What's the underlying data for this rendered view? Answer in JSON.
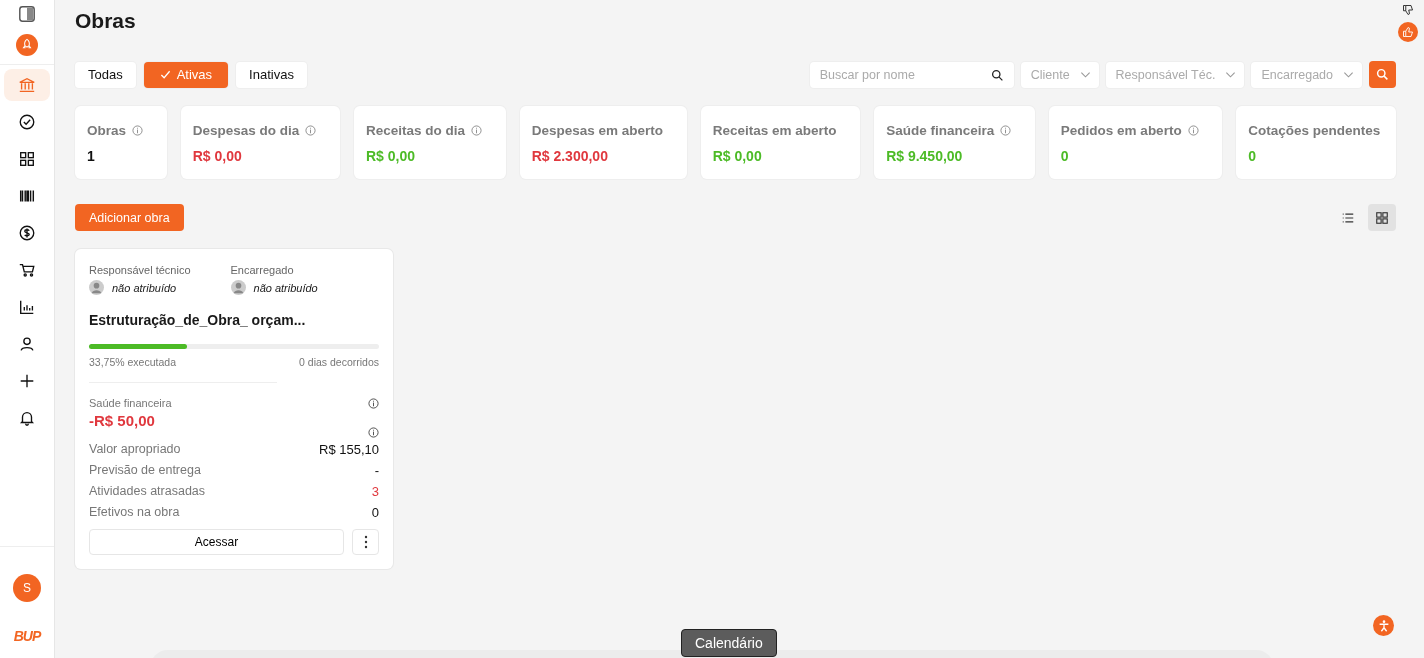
{
  "sidebar": {
    "items": [
      {
        "kind": "bank",
        "selected": true
      },
      {
        "kind": "check",
        "selected": false
      },
      {
        "kind": "grid",
        "selected": false
      },
      {
        "kind": "barcode",
        "selected": false
      },
      {
        "kind": "dollar",
        "selected": false
      },
      {
        "kind": "cart",
        "selected": false
      },
      {
        "kind": "chart",
        "selected": false
      },
      {
        "kind": "user",
        "selected": false
      },
      {
        "kind": "plus",
        "selected": false
      },
      {
        "kind": "bell",
        "selected": false
      }
    ],
    "avatar": "S",
    "logo": "BUP"
  },
  "title": "Obras",
  "tabs": [
    {
      "label": "Todas",
      "selected": false
    },
    {
      "label": "Ativas",
      "selected": true
    },
    {
      "label": "Inativas",
      "selected": false
    }
  ],
  "search": {
    "placeholder": "Buscar por nome"
  },
  "filters": [
    {
      "placeholder": "Cliente"
    },
    {
      "placeholder": "Responsável Téc."
    },
    {
      "placeholder": "Encarregado"
    }
  ],
  "stats": [
    {
      "label": "Obras",
      "value": "1",
      "color": "#111111",
      "info": true
    },
    {
      "label": "Despesas do dia",
      "value": "R$ 0,00",
      "color": "#e0383e",
      "info": true
    },
    {
      "label": "Receitas do dia",
      "value": "R$ 0,00",
      "color": "#4cbb26",
      "info": true
    },
    {
      "label": "Despesas em aberto",
      "value": "R$ 2.300,00",
      "color": "#e0383e",
      "info": false
    },
    {
      "label": "Receitas em aberto",
      "value": "R$ 0,00",
      "color": "#4cbb26",
      "info": false
    },
    {
      "label": "Saúde financeira",
      "value": "R$ 9.450,00",
      "color": "#4cbb26",
      "info": true
    },
    {
      "label": "Pedidos em aberto",
      "value": "0",
      "color": "#4cbb26",
      "info": true
    },
    {
      "label": "Cotações pendentes",
      "value": "0",
      "color": "#4cbb26",
      "info": false
    }
  ],
  "add_button": "Adicionar obra",
  "view_modes": [
    {
      "kind": "list",
      "selected": false
    },
    {
      "kind": "grid",
      "selected": true
    }
  ],
  "project": {
    "people": [
      {
        "role": "Responsável técnico",
        "name": "não atribuído"
      },
      {
        "role": "Encarregado",
        "name": "não atribuído"
      }
    ],
    "name": "Estruturação_de_Obra_ orçam...",
    "level": 0.3375,
    "executed": "33,75% executada",
    "elapsed": "0 dias decorridos",
    "health_label": "Saúde financeira",
    "health_value": "-R$ 50,00",
    "details": [
      {
        "label": "Valor apropriado",
        "value": "R$ 155,10",
        "kind": "plain"
      },
      {
        "label": "Previsão de entrega",
        "value": "-",
        "kind": "plain"
      },
      {
        "label": "Atividades atrasadas",
        "value": "3",
        "kind": "alert"
      },
      {
        "label": "Efetivos na obra",
        "value": "0",
        "kind": "plain"
      }
    ],
    "open_button": "Acessar"
  },
  "tooltip": "Calendário"
}
